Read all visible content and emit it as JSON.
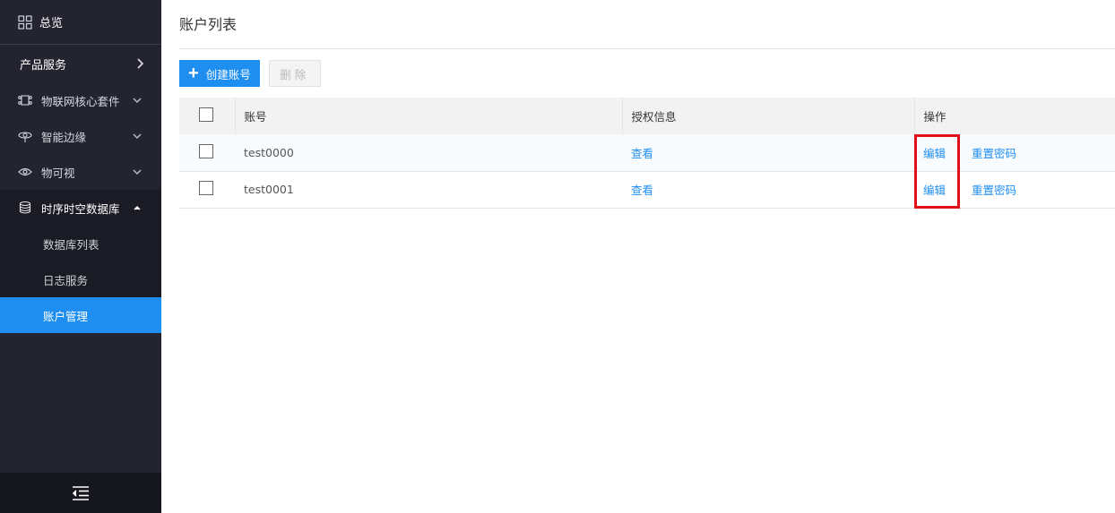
{
  "sidebar": {
    "overview": {
      "label": "总览",
      "icon": "grid-icon"
    },
    "product_services": {
      "label": "产品服务",
      "icon": "chevron-right-icon"
    },
    "items": [
      {
        "label": "物联网核心套件",
        "icon": "iot-suite-icon",
        "expanded": false
      },
      {
        "label": "智能边缘",
        "icon": "edge-icon",
        "expanded": false
      },
      {
        "label": "物可视",
        "icon": "eye-icon",
        "expanded": false
      },
      {
        "label": "时序时空数据库",
        "icon": "database-icon",
        "expanded": true
      }
    ],
    "sub_items": [
      {
        "label": "数据库列表",
        "active": false
      },
      {
        "label": "日志服务",
        "active": false
      },
      {
        "label": "账户管理",
        "active": true
      }
    ],
    "collapse_icon": "collapse-menu-icon"
  },
  "main": {
    "title": "账户列表",
    "toolbar": {
      "create_label": "创建账号",
      "delete_label": "删除"
    },
    "table": {
      "headers": {
        "account": "账号",
        "auth": "授权信息",
        "ops": "操作"
      },
      "rows": [
        {
          "account": "test0000",
          "auth_link": "查看",
          "edit": "编辑",
          "reset": "重置密码"
        },
        {
          "account": "test0001",
          "auth_link": "查看",
          "edit": "编辑",
          "reset": "重置密码"
        }
      ]
    }
  },
  "colors": {
    "accent": "#1f8ef1",
    "sidebar_bg": "#232430",
    "highlight": "#e0101a"
  }
}
